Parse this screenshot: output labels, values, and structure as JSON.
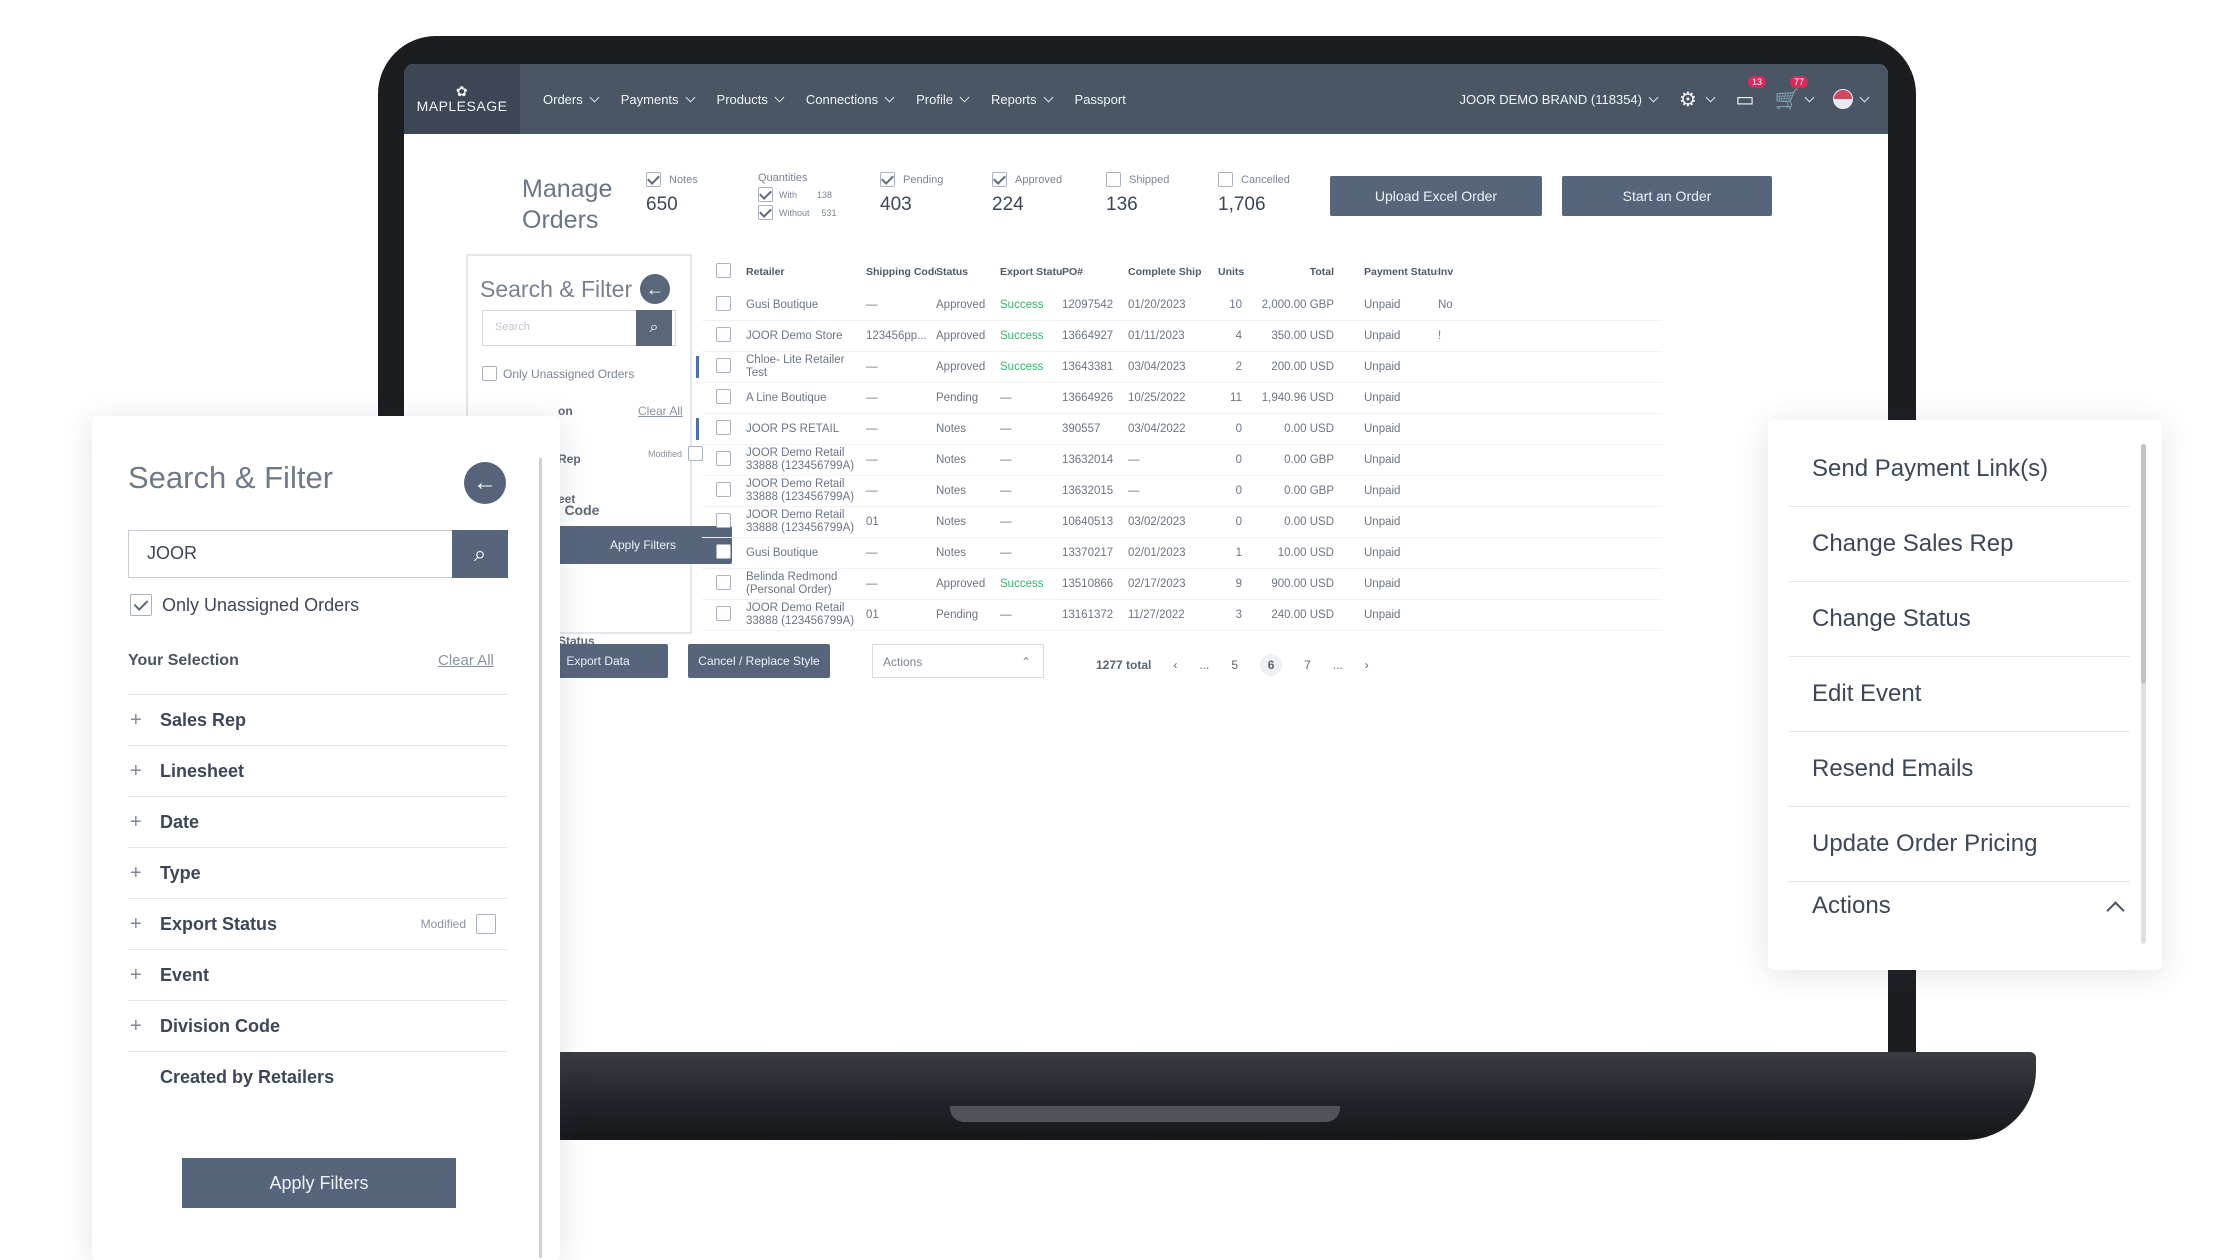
{
  "nav": {
    "logo": "MAPLESAGE",
    "items": [
      "Orders",
      "Payments",
      "Products",
      "Connections",
      "Profile",
      "Reports",
      "Passport"
    ],
    "brand": "JOOR DEMO BRAND (118354)",
    "messages_badge": "13",
    "cart_badge": "77"
  },
  "header": {
    "title_line1": "Manage",
    "title_line2": "Orders",
    "stats": [
      {
        "label": "Notes",
        "value": "650",
        "checked": true
      },
      {
        "label": "Pending",
        "value": "403",
        "checked": true
      },
      {
        "label": "Approved",
        "value": "224",
        "checked": true
      },
      {
        "label": "Shipped",
        "value": "136",
        "checked": false
      },
      {
        "label": "Cancelled",
        "value": "1,706",
        "checked": false
      }
    ],
    "quantities_label": "Quantities",
    "with_label": "With",
    "with_value": "138",
    "without_label": "Without",
    "without_value": "531",
    "upload_button": "Upload Excel Order",
    "start_button": "Start an Order"
  },
  "small_filter": {
    "title": "Search & Filter",
    "search_placeholder": "Search",
    "unassigned": "Only Unassigned Orders",
    "frag_on": "on",
    "clear": "Clear All",
    "frag_rep": "Rep",
    "frag_eet": "eet",
    "status_frag": "Status",
    "modified": "Modified",
    "code_frag": "n Code",
    "apply": "Apply Filters"
  },
  "table": {
    "headers": [
      "Retailer",
      "Shipping Code",
      "Status",
      "Export Status",
      "PO#",
      "Complete Ship",
      "Units",
      "Total",
      "Payment Status",
      "Inv"
    ],
    "rows": [
      {
        "retailer": "Gusi Boutique",
        "ship": "—",
        "status": "Approved",
        "export": "Success",
        "po": "12097542",
        "cs": "01/20/2023",
        "units": "10",
        "total": "2,000.00 GBP",
        "pay": "Unpaid",
        "inv": "No"
      },
      {
        "retailer": "JOOR Demo Store",
        "ship": "123456pp...",
        "status": "Approved",
        "export": "Success",
        "po": "13664927",
        "cs": "01/11/2023",
        "units": "4",
        "total": "350.00 USD",
        "pay": "Unpaid",
        "inv": "!"
      },
      {
        "retailer": "Chloe- Lite Retailer Test",
        "ship": "—",
        "status": "Approved",
        "export": "Success",
        "po": "13643381",
        "cs": "03/04/2023",
        "units": "2",
        "total": "200.00 USD",
        "pay": "Unpaid",
        "inv": ""
      },
      {
        "retailer": "A Line Boutique",
        "ship": "—",
        "status": "Pending",
        "export": "—",
        "po": "13664926",
        "cs": "10/25/2022",
        "units": "11",
        "total": "1,940.96 USD",
        "pay": "Unpaid",
        "inv": ""
      },
      {
        "retailer": "JOOR PS RETAIL",
        "ship": "—",
        "status": "Notes",
        "export": "—",
        "po": "390557",
        "cs": "03/04/2022",
        "units": "0",
        "total": "0.00 USD",
        "pay": "Unpaid",
        "inv": ""
      },
      {
        "retailer": "JOOR Demo Retail 33888 (123456799A)",
        "ship": "—",
        "status": "Notes",
        "export": "—",
        "po": "13632014",
        "cs": "—",
        "units": "0",
        "total": "0.00 GBP",
        "pay": "Unpaid",
        "inv": ""
      },
      {
        "retailer": "JOOR Demo Retail 33888 (123456799A)",
        "ship": "—",
        "status": "Notes",
        "export": "—",
        "po": "13632015",
        "cs": "—",
        "units": "0",
        "total": "0.00 GBP",
        "pay": "Unpaid",
        "inv": ""
      },
      {
        "retailer": "JOOR Demo Retail 33888 (123456799A)",
        "ship": "01",
        "status": "Notes",
        "export": "—",
        "po": "10640513",
        "cs": "03/02/2023",
        "units": "0",
        "total": "0.00 USD",
        "pay": "Unpaid",
        "inv": ""
      },
      {
        "retailer": "Gusi Boutique",
        "ship": "—",
        "status": "Notes",
        "export": "—",
        "po": "13370217",
        "cs": "02/01/2023",
        "units": "1",
        "total": "10.00 USD",
        "pay": "Unpaid",
        "inv": ""
      },
      {
        "retailer": "Belinda Redmond (Personal Order)",
        "ship": "—",
        "status": "Approved",
        "export": "Success",
        "po": "13510866",
        "cs": "02/17/2023",
        "units": "9",
        "total": "900.00 USD",
        "pay": "Unpaid",
        "inv": ""
      },
      {
        "retailer": "JOOR Demo Retail 33888 (123456799A)",
        "ship": "01",
        "status": "Pending",
        "export": "—",
        "po": "13161372",
        "cs": "11/27/2022",
        "units": "3",
        "total": "240.00 USD",
        "pay": "Unpaid",
        "inv": ""
      }
    ]
  },
  "bottom": {
    "export_button": "Export Data",
    "cancel_replace": "Cancel / Replace Style",
    "actions_select": "Actions",
    "total": "1277 total",
    "pages": [
      "‹",
      "...",
      "5",
      "6",
      "7",
      "...",
      "›"
    ],
    "current_page": "6"
  },
  "filter_card": {
    "title": "Search & Filter",
    "search_value": "JOOR",
    "unassigned": "Only Unassigned Orders",
    "your_selection": "Your Selection",
    "clear_all": "Clear All",
    "items": [
      {
        "label": "Sales Rep",
        "plus": "+"
      },
      {
        "label": "Linesheet",
        "plus": "+"
      },
      {
        "label": "Date",
        "plus": "+"
      },
      {
        "label": "Type",
        "plus": "+"
      },
      {
        "label": "Export Status",
        "plus": "+",
        "modified": "Modified"
      },
      {
        "label": "Event",
        "plus": "+"
      },
      {
        "label": "Division Code",
        "plus": "+"
      },
      {
        "label": "Created by Retailers",
        "plus": ""
      }
    ],
    "apply": "Apply Filters"
  },
  "actions_menu": {
    "items": [
      "Send Payment Link(s)",
      "Change Sales Rep",
      "Change Status",
      "Edit Event",
      "Resend Emails",
      "Update Order Pricing"
    ],
    "footer": "Actions"
  }
}
